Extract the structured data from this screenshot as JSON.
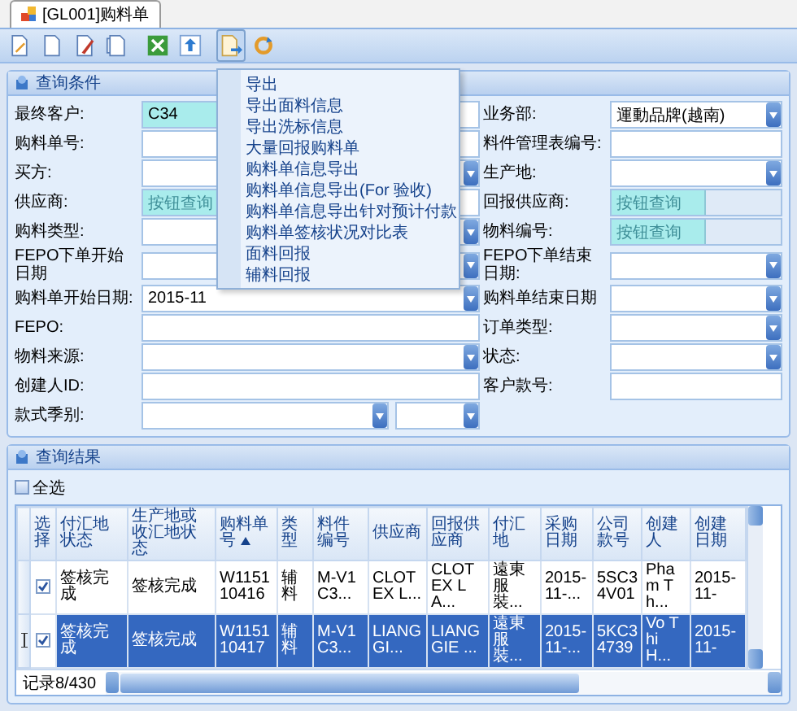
{
  "tab": {
    "label": "[GL001]购料单",
    "selected": true
  },
  "toolbar": [
    {
      "kind": "edit-doc",
      "pressed": false
    },
    {
      "kind": "blank-doc",
      "pressed": false
    },
    {
      "kind": "pencil-doc",
      "pressed": false
    },
    {
      "kind": "copy-doc",
      "pressed": false
    },
    {
      "kind": "excel",
      "pressed": false
    },
    {
      "kind": "upload",
      "pressed": false
    },
    {
      "kind": "export",
      "pressed": true
    },
    {
      "kind": "refresh",
      "pressed": false
    }
  ],
  "export_menu": {
    "items": [
      "导出",
      "导出面料信息",
      "导出洗标信息",
      "大量回报购料单",
      "购料单信息导出",
      "购料单信息导出(For 验收)",
      "购料单信息导出针对预计付款",
      "购料单签核状况对比表",
      "面料回报",
      "辅料回报"
    ]
  },
  "query_panel": {
    "title": "查询条件",
    "rows": [
      {
        "left": {
          "label": "最终客户:",
          "kind": "lookup",
          "value": "C34"
        },
        "right": {
          "label": "业务部:",
          "kind": "dropdown",
          "value": "運動品牌(越南)"
        }
      },
      {
        "left": {
          "label": "购料单号:",
          "kind": "text"
        },
        "right": {
          "label": "料件管理表编号:",
          "kind": "text"
        }
      },
      {
        "left": {
          "label": "买方:",
          "kind": "dropdown"
        },
        "right": {
          "label": "生产地:",
          "kind": "dropdown"
        }
      },
      {
        "left": {
          "label": "供应商:",
          "kind": "lookup",
          "placeholder": "按钮查询"
        },
        "right": {
          "label": "回报供应商:",
          "kind": "lookup",
          "placeholder": "按钮查询",
          "disabled": true
        }
      },
      {
        "left": {
          "label": "购料类型:",
          "kind": "dropdown"
        },
        "right": {
          "label": "物料编号:",
          "kind": "lookup",
          "placeholder": "按钮查询",
          "disabled": true
        }
      },
      {
        "left": {
          "label": "FEPO下单开始日期",
          "kind": "dropdown"
        },
        "right": {
          "label": "FEPO下单结束日期:",
          "kind": "dropdown"
        }
      },
      {
        "left": {
          "label": "购料单开始日期:",
          "kind": "dropdown",
          "value": "2015-11"
        },
        "right": {
          "label": "购料单结束日期",
          "kind": "dropdown"
        }
      },
      {
        "left": {
          "label": "FEPO:",
          "kind": "text"
        },
        "right": {
          "label": "订单类型:",
          "kind": "dropdown"
        }
      },
      {
        "left": {
          "label": "物料来源:",
          "kind": "dropdown"
        },
        "right": {
          "label": "状态:",
          "kind": "dropdown"
        }
      },
      {
        "left": {
          "label": "创建人ID:",
          "kind": "text"
        },
        "right": {
          "label": "客户款号:",
          "kind": "text"
        }
      },
      {
        "left": {
          "label": "款式季别:",
          "kind": "double_dropdown"
        }
      }
    ]
  },
  "results_panel": {
    "title": "查询结果",
    "select_all": {
      "label": "全选",
      "checked": false
    },
    "columns": [
      {
        "label": "选择"
      },
      {
        "label": "付汇地状态"
      },
      {
        "label": "生产地或收汇地状态"
      },
      {
        "label": "购料单号",
        "sorted": true
      },
      {
        "label": "类型"
      },
      {
        "label": "料件编号"
      },
      {
        "label": "供应商"
      },
      {
        "label": "回报供应商"
      },
      {
        "label": "付汇地"
      },
      {
        "label": "采购日期"
      },
      {
        "label": "公司款号"
      },
      {
        "label": "创建人"
      },
      {
        "label": "创建日期"
      }
    ],
    "rows": [
      {
        "selected": false,
        "cells": [
          {
            "kind": "checkbox",
            "checked": true
          },
          "签核完成",
          "签核完成",
          "W115110416",
          "辅料",
          "M-V1C3...",
          "CLOTEX L...",
          "CLOTEX LA...",
          "遠東服裝...",
          "2015-11-...",
          "5SC34V01",
          "Pham Th...",
          "2015-11-"
        ]
      },
      {
        "selected": true,
        "cells": [
          {
            "kind": "checkbox",
            "checked": true
          },
          "签核完成",
          "签核完成",
          "W115110417",
          "辅料",
          "M-V1C3...",
          "LIANG GI...",
          "LIANG GIE ...",
          "遠東服裝...",
          "2015-11-...",
          "5KC34739",
          "Vo Thi H...",
          "2015-11-"
        ]
      }
    ],
    "record_count": "记录8/430"
  }
}
